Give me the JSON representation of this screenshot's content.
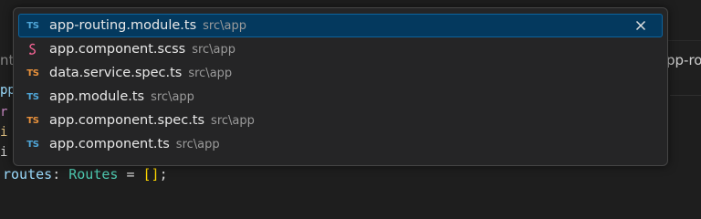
{
  "quick_open": {
    "items": [
      {
        "name": "app-routing.module.ts",
        "path": "src\\app",
        "icon": "typescript-file-icon",
        "icon_text": "TS",
        "icon_color": "#4fa6d8",
        "selected": true
      },
      {
        "name": "app.component.scss",
        "path": "src\\app",
        "icon": "scss-file-icon",
        "icon_text": "",
        "icon_color": "#f06292",
        "selected": false
      },
      {
        "name": "data.service.spec.ts",
        "path": "src\\app",
        "icon": "typescript-spec-file-icon",
        "icon_text": "TS",
        "icon_color": "#e8913c",
        "selected": false
      },
      {
        "name": "app.module.ts",
        "path": "src\\app",
        "icon": "typescript-file-icon",
        "icon_text": "TS",
        "icon_color": "#4fa6d8",
        "selected": false
      },
      {
        "name": "app.component.spec.ts",
        "path": "src\\app",
        "icon": "typescript-spec-file-icon",
        "icon_text": "TS",
        "icon_color": "#e8913c",
        "selected": false
      },
      {
        "name": "app.component.ts",
        "path": "src\\app",
        "icon": "typescript-file-icon",
        "icon_text": "TS",
        "icon_color": "#4fa6d8",
        "selected": false
      }
    ],
    "close_glyph": "✕",
    "selection_color": "#04395e"
  },
  "editor": {
    "tab_fragment_left": "nt",
    "tab_fragment_right": "pp-ro",
    "left_fragments": [
      "pp",
      "r",
      "i",
      "i"
    ],
    "code_line": {
      "variable": "routes",
      "colon": ": ",
      "type": "Routes",
      "equals": " = ",
      "value": "[]",
      "terminator": ";"
    }
  }
}
